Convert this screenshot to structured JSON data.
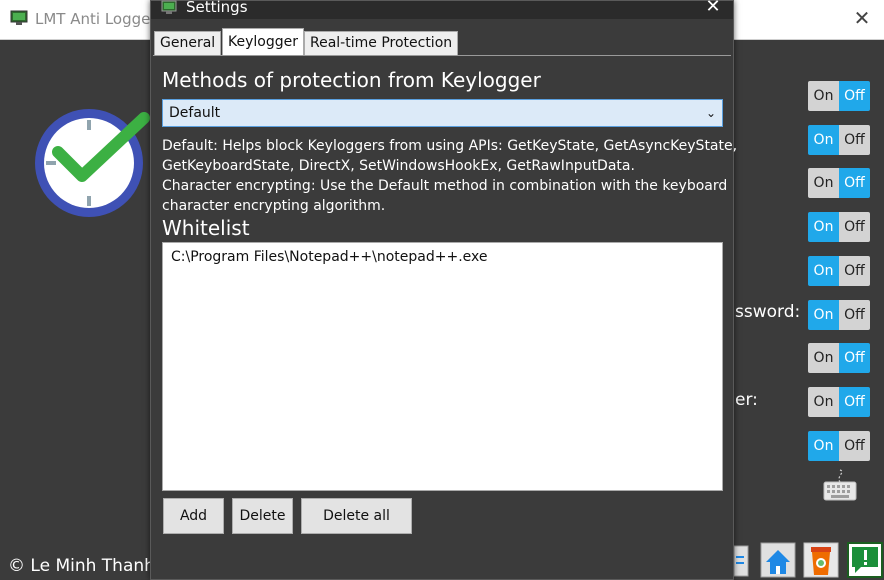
{
  "main": {
    "title": "LMT Anti Logger",
    "close_glyph": "✕",
    "copyright": "© Le Minh Thanh",
    "partial_labels": [
      "ssword:",
      "er:"
    ],
    "toggles": [
      {
        "on_label": "On",
        "off_label": "Off",
        "state": "off"
      },
      {
        "on_label": "On",
        "off_label": "Off",
        "state": "on"
      },
      {
        "on_label": "On",
        "off_label": "Off",
        "state": "off"
      },
      {
        "on_label": "On",
        "off_label": "Off",
        "state": "on"
      },
      {
        "on_label": "On",
        "off_label": "Off",
        "state": "on"
      },
      {
        "on_label": "On",
        "off_label": "Off",
        "state": "on"
      },
      {
        "on_label": "On",
        "off_label": "Off",
        "state": "off"
      },
      {
        "on_label": "On",
        "off_label": "Off",
        "state": "off"
      },
      {
        "on_label": "On",
        "off_label": "Off",
        "state": "on"
      }
    ],
    "icons": [
      "clock-check-icon",
      "keyboard-icon",
      "document-icon",
      "home-icon",
      "coffee-cup-icon",
      "notification-icon"
    ]
  },
  "settings": {
    "title": "Settings",
    "close_glyph": "✕",
    "tabs": [
      {
        "label": "General",
        "active": false
      },
      {
        "label": "Keylogger",
        "active": true
      },
      {
        "label": "Real-time Protection",
        "active": false
      }
    ],
    "methods_title": "Methods of protection from Keylogger",
    "method_selected": "Default",
    "description": [
      "Default: Helps block Keyloggers from using APIs: GetKeyState, GetAsyncKeyState,",
      "GetKeyboardState, DirectX, SetWindowsHookEx, GetRawInputData.",
      "Character encrypting: Use the Default method in combination with the keyboard",
      "character encrypting algorithm."
    ],
    "whitelist_title": "Whitelist",
    "whitelist": [
      "C:\\Program Files\\Notepad++\\notepad++.exe"
    ],
    "buttons": {
      "add": "Add",
      "delete": "Delete",
      "delete_all": "Delete all"
    }
  },
  "colors": {
    "accent": "#20a8ea",
    "window_bg": "#3b3b3b",
    "check_green": "#3cb043",
    "clock_ring": "#3f51b5"
  }
}
